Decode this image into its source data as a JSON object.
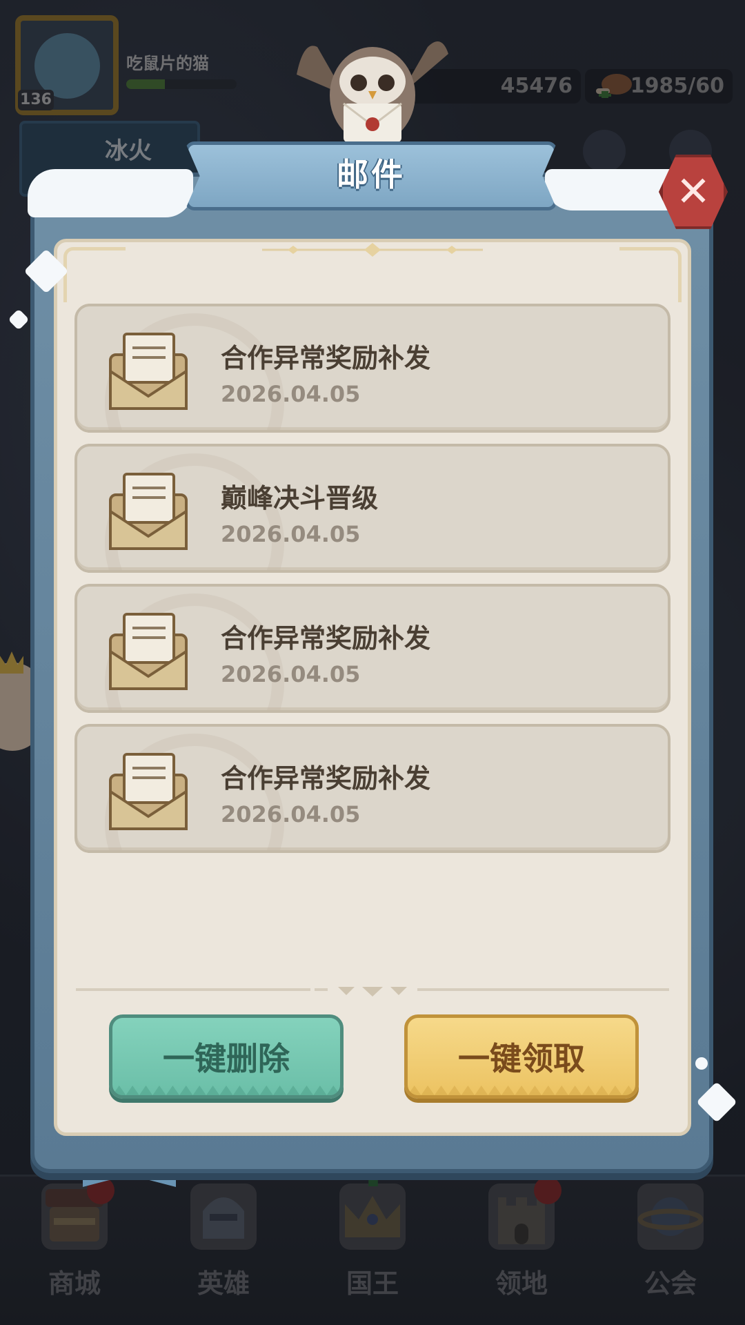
{
  "hud": {
    "player_name": "吃鼠片的猫",
    "level": "136",
    "xp_fraction": 0.35,
    "gold": "45476",
    "stamina": "1985/60",
    "side_banner": "冰火"
  },
  "dialog": {
    "title": "邮件",
    "close_icon": "✕"
  },
  "mails": [
    {
      "title": "合作异常奖励补发",
      "date": "2026.04.05"
    },
    {
      "title": "巅峰决斗晋级",
      "date": "2026.04.05"
    },
    {
      "title": "合作异常奖励补发",
      "date": "2026.04.05"
    },
    {
      "title": "合作异常奖励补发",
      "date": "2026.04.05"
    }
  ],
  "buttons": {
    "delete_all": "一键删除",
    "claim_all": "一键领取"
  },
  "nav": {
    "items": [
      {
        "label": "商城",
        "icon": "shop-icon"
      },
      {
        "label": "英雄",
        "icon": "helmet-icon"
      },
      {
        "label": "国王",
        "icon": "crown-icon"
      },
      {
        "label": "领地",
        "icon": "castle-icon"
      },
      {
        "label": "公会",
        "icon": "planet-icon"
      }
    ]
  },
  "colors": {
    "delete_button": "#6bbfa8",
    "claim_button": "#ecc362",
    "close_button": "#b9423e",
    "frame": "#5a7a93"
  }
}
